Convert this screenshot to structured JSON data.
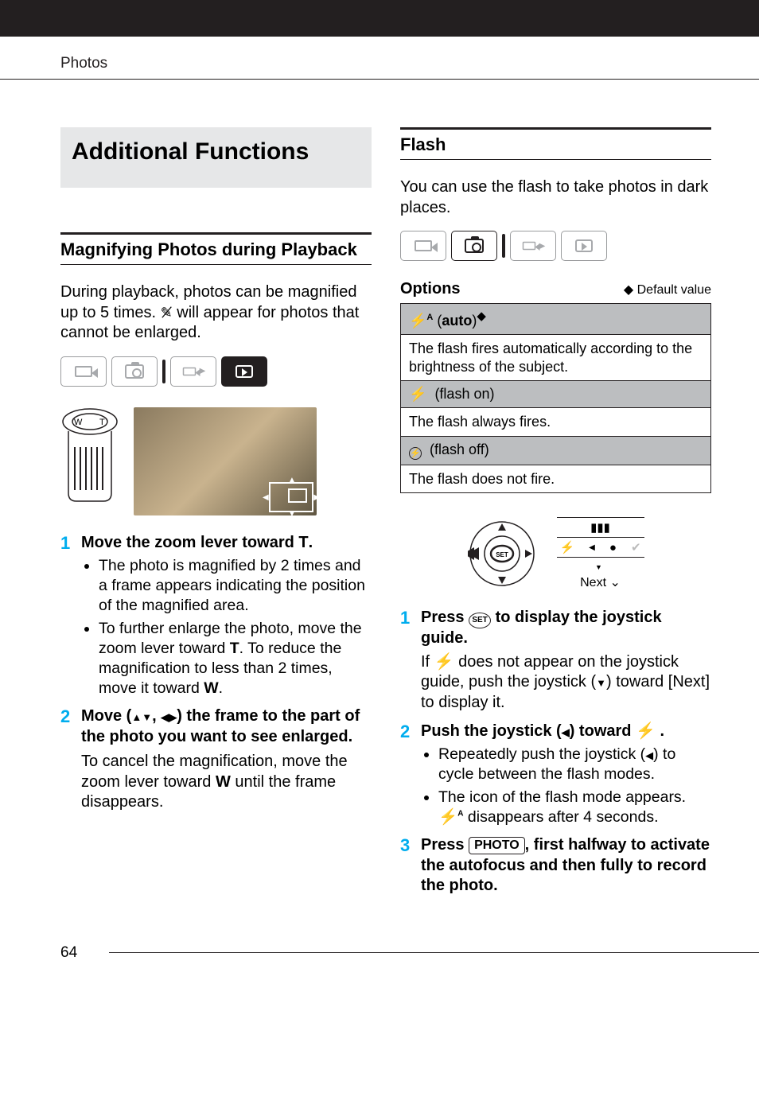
{
  "header": {
    "section": "Photos"
  },
  "page_number": "64",
  "left": {
    "block_title": "Additional Functions",
    "h2": "Magnifying Photos during Playback",
    "intro": "During playback, photos can be magnified up to 5 times.",
    "intro_suffix": " will appear for photos that cannot be enlarged.",
    "wt_w": "W",
    "wt_t": "T",
    "step1_title_a": "Move the zoom lever toward ",
    "step1_title_b": ".",
    "step1_b1": "The photo is magnified by 2 times and a frame appears indicating the position of the magnified area.",
    "step1_b2a": "To further enlarge the photo, move the zoom lever toward ",
    "step1_b2b": ". To reduce the magnification to less than 2 times, move it toward ",
    "step1_b2c": ".",
    "step2_title_a": "Move (",
    "step2_title_b": ", ",
    "step2_title_c": ") the frame to the part of the photo you want to see enlarged.",
    "step2_body_a": "To cancel the magnification, move the zoom lever toward ",
    "step2_body_b": " until the frame disappears.",
    "T": "T",
    "W": "W"
  },
  "right": {
    "h2": "Flash",
    "intro": "You can use the flash to take photos in dark places.",
    "options_label": "Options",
    "default_label": "Default value",
    "opt1_name_a": "(",
    "opt1_name_b": "auto",
    "opt1_name_c": ")",
    "opt1_desc": "The flash fires automatically according to the brightness of the subject.",
    "opt2_name": "(flash on)",
    "opt2_desc": "The flash always fires.",
    "opt3_name": "(flash off)",
    "opt3_desc": "The flash does not fire.",
    "joy_next": "Next",
    "step1_title": "Press       to display the joystick guide.",
    "step1_set_label": "SET",
    "step1_body_a": "If ",
    "step1_body_b": " does not appear on the joystick guide, push the joystick (",
    "step1_body_c": ") toward [Next] to display it.",
    "step2_title_a": "Push the joystick (",
    "step2_title_b": ") toward ",
    "step2_title_c": " .",
    "step2_b1_a": "Repeatedly push the joystick (",
    "step2_b1_b": ") to cycle between the flash modes.",
    "step2_b2_a": "The icon of the flash mode appears. ",
    "step2_b2_b": " disappears after 4 seconds.",
    "step3_a": "Press ",
    "step3_photo": "PHOTO",
    "step3_b": ", first halfway to activate the autofocus and then fully to record the photo."
  }
}
